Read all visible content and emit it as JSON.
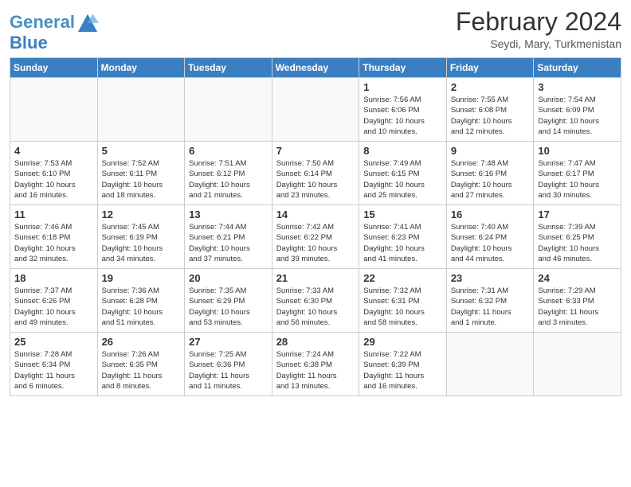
{
  "header": {
    "logo_line1": "General",
    "logo_line2": "Blue",
    "title": "February 2024",
    "subtitle": "Seydi, Mary, Turkmenistan"
  },
  "days_of_week": [
    "Sunday",
    "Monday",
    "Tuesday",
    "Wednesday",
    "Thursday",
    "Friday",
    "Saturday"
  ],
  "weeks": [
    [
      {
        "day": "",
        "info": ""
      },
      {
        "day": "",
        "info": ""
      },
      {
        "day": "",
        "info": ""
      },
      {
        "day": "",
        "info": ""
      },
      {
        "day": "1",
        "info": "Sunrise: 7:56 AM\nSunset: 6:06 PM\nDaylight: 10 hours\nand 10 minutes."
      },
      {
        "day": "2",
        "info": "Sunrise: 7:55 AM\nSunset: 6:08 PM\nDaylight: 10 hours\nand 12 minutes."
      },
      {
        "day": "3",
        "info": "Sunrise: 7:54 AM\nSunset: 6:09 PM\nDaylight: 10 hours\nand 14 minutes."
      }
    ],
    [
      {
        "day": "4",
        "info": "Sunrise: 7:53 AM\nSunset: 6:10 PM\nDaylight: 10 hours\nand 16 minutes."
      },
      {
        "day": "5",
        "info": "Sunrise: 7:52 AM\nSunset: 6:11 PM\nDaylight: 10 hours\nand 18 minutes."
      },
      {
        "day": "6",
        "info": "Sunrise: 7:51 AM\nSunset: 6:12 PM\nDaylight: 10 hours\nand 21 minutes."
      },
      {
        "day": "7",
        "info": "Sunrise: 7:50 AM\nSunset: 6:14 PM\nDaylight: 10 hours\nand 23 minutes."
      },
      {
        "day": "8",
        "info": "Sunrise: 7:49 AM\nSunset: 6:15 PM\nDaylight: 10 hours\nand 25 minutes."
      },
      {
        "day": "9",
        "info": "Sunrise: 7:48 AM\nSunset: 6:16 PM\nDaylight: 10 hours\nand 27 minutes."
      },
      {
        "day": "10",
        "info": "Sunrise: 7:47 AM\nSunset: 6:17 PM\nDaylight: 10 hours\nand 30 minutes."
      }
    ],
    [
      {
        "day": "11",
        "info": "Sunrise: 7:46 AM\nSunset: 6:18 PM\nDaylight: 10 hours\nand 32 minutes."
      },
      {
        "day": "12",
        "info": "Sunrise: 7:45 AM\nSunset: 6:19 PM\nDaylight: 10 hours\nand 34 minutes."
      },
      {
        "day": "13",
        "info": "Sunrise: 7:44 AM\nSunset: 6:21 PM\nDaylight: 10 hours\nand 37 minutes."
      },
      {
        "day": "14",
        "info": "Sunrise: 7:42 AM\nSunset: 6:22 PM\nDaylight: 10 hours\nand 39 minutes."
      },
      {
        "day": "15",
        "info": "Sunrise: 7:41 AM\nSunset: 6:23 PM\nDaylight: 10 hours\nand 41 minutes."
      },
      {
        "day": "16",
        "info": "Sunrise: 7:40 AM\nSunset: 6:24 PM\nDaylight: 10 hours\nand 44 minutes."
      },
      {
        "day": "17",
        "info": "Sunrise: 7:39 AM\nSunset: 6:25 PM\nDaylight: 10 hours\nand 46 minutes."
      }
    ],
    [
      {
        "day": "18",
        "info": "Sunrise: 7:37 AM\nSunset: 6:26 PM\nDaylight: 10 hours\nand 49 minutes."
      },
      {
        "day": "19",
        "info": "Sunrise: 7:36 AM\nSunset: 6:28 PM\nDaylight: 10 hours\nand 51 minutes."
      },
      {
        "day": "20",
        "info": "Sunrise: 7:35 AM\nSunset: 6:29 PM\nDaylight: 10 hours\nand 53 minutes."
      },
      {
        "day": "21",
        "info": "Sunrise: 7:33 AM\nSunset: 6:30 PM\nDaylight: 10 hours\nand 56 minutes."
      },
      {
        "day": "22",
        "info": "Sunrise: 7:32 AM\nSunset: 6:31 PM\nDaylight: 10 hours\nand 58 minutes."
      },
      {
        "day": "23",
        "info": "Sunrise: 7:31 AM\nSunset: 6:32 PM\nDaylight: 11 hours\nand 1 minute."
      },
      {
        "day": "24",
        "info": "Sunrise: 7:29 AM\nSunset: 6:33 PM\nDaylight: 11 hours\nand 3 minutes."
      }
    ],
    [
      {
        "day": "25",
        "info": "Sunrise: 7:28 AM\nSunset: 6:34 PM\nDaylight: 11 hours\nand 6 minutes."
      },
      {
        "day": "26",
        "info": "Sunrise: 7:26 AM\nSunset: 6:35 PM\nDaylight: 11 hours\nand 8 minutes."
      },
      {
        "day": "27",
        "info": "Sunrise: 7:25 AM\nSunset: 6:36 PM\nDaylight: 11 hours\nand 11 minutes."
      },
      {
        "day": "28",
        "info": "Sunrise: 7:24 AM\nSunset: 6:38 PM\nDaylight: 11 hours\nand 13 minutes."
      },
      {
        "day": "29",
        "info": "Sunrise: 7:22 AM\nSunset: 6:39 PM\nDaylight: 11 hours\nand 16 minutes."
      },
      {
        "day": "",
        "info": ""
      },
      {
        "day": "",
        "info": ""
      }
    ]
  ]
}
